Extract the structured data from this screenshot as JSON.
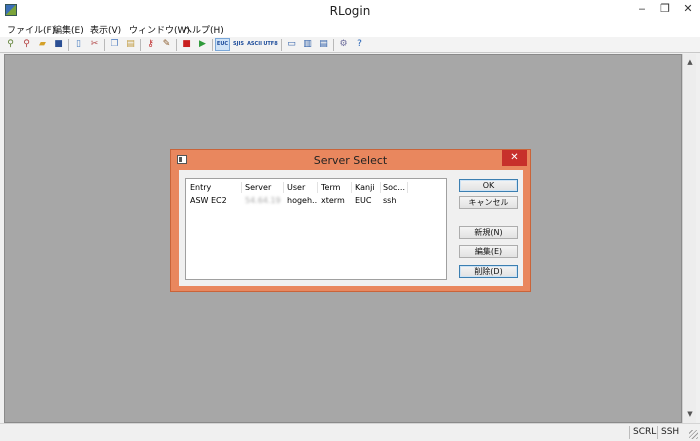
{
  "window": {
    "title": "RLogin",
    "minimize": "‒",
    "restore": "❐",
    "close": "✕"
  },
  "menu": [
    {
      "label": "ファイル(F)"
    },
    {
      "label": "編集(E)"
    },
    {
      "label": "表示(V)"
    },
    {
      "label": "ウィンドウ(W)"
    },
    {
      "label": "ヘルプ(H)"
    }
  ],
  "toolbar": {
    "encodings": [
      "EUC",
      "SJIS",
      "ASCII",
      "UTF8"
    ],
    "active_encoding": "EUC"
  },
  "statusbar": {
    "scroll": "SCRL",
    "protocol": "SSH"
  },
  "dialog": {
    "title": "Server Select",
    "close": "✕",
    "columns": [
      "Entry",
      "Server",
      "User",
      "Term",
      "Kanji",
      "Soc..."
    ],
    "rows": [
      {
        "entry": "ASW EC2",
        "server": "54.64.190",
        "user": "hogeh...",
        "term": "xterm",
        "kanji": "EUC",
        "socket": "ssh"
      }
    ],
    "buttons": {
      "ok": "OK",
      "cancel": "キャンセル",
      "new": "新規(N)",
      "edit": "編集(E)",
      "delete": "削除(D)"
    }
  }
}
